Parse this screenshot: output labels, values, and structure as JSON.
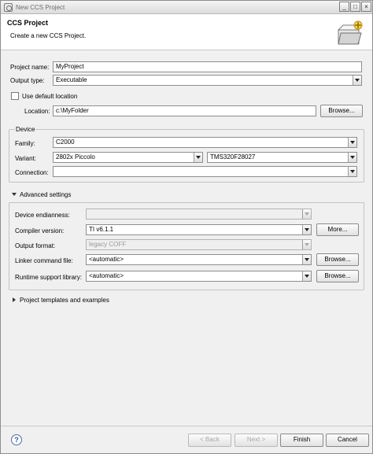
{
  "window": {
    "title": "New CCS Project"
  },
  "header": {
    "title": "CCS Project",
    "description": "Create a new CCS Project."
  },
  "form": {
    "project_name_label": "Project name:",
    "project_name_value": "MyProject",
    "output_type_label": "Output type:",
    "output_type_value": "Executable",
    "use_default_location_label": "Use default location",
    "use_default_location_checked": false,
    "location_label": "Location:",
    "location_value": "c:\\MyFolder",
    "browse_label": "Browse..."
  },
  "device": {
    "group_title": "Device",
    "family_label": "Family:",
    "family_value": "C2000",
    "variant_label": "Variant:",
    "variant_value": "2802x Piccolo",
    "variant_chip_value": "TMS320F28027",
    "connection_label": "Connection:",
    "connection_value": ""
  },
  "advanced": {
    "section_label": "Advanced settings",
    "expanded": true,
    "endianness_label": "Device endianness:",
    "endianness_value": "",
    "compiler_label": "Compiler version:",
    "compiler_value": "TI v6.1.1",
    "more_label": "More...",
    "output_format_label": "Output format:",
    "output_format_value": "legacy COFF",
    "linker_label": "Linker command file:",
    "linker_value": "<automatic>",
    "linker_browse_label": "Browse...",
    "runtime_label": "Runtime support library:",
    "runtime_value": "<automatic>",
    "runtime_browse_label": "Browse..."
  },
  "templates": {
    "section_label": "Project templates and examples",
    "expanded": false
  },
  "footer": {
    "back_label": "< Back",
    "next_label": "Next >",
    "finish_label": "Finish",
    "cancel_label": "Cancel"
  },
  "icons": {
    "app": "eclipse-app-icon",
    "header": "folder-wizard-icon",
    "help": "help-icon"
  }
}
